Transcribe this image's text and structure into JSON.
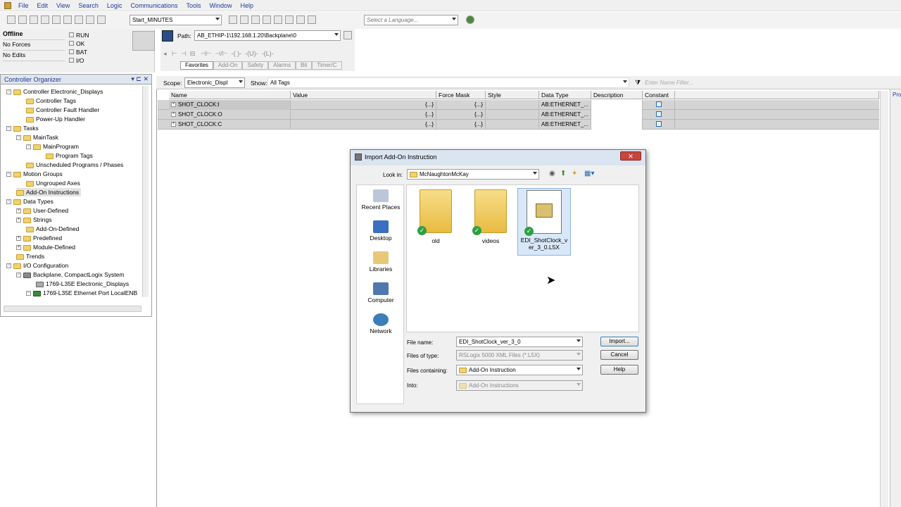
{
  "menu": [
    "File",
    "Edit",
    "View",
    "Search",
    "Logic",
    "Communications",
    "Tools",
    "Window",
    "Help"
  ],
  "toolbar": {
    "routine_combo": "Start_MINUTES",
    "language_placeholder": "Select a Language..."
  },
  "status": {
    "mode": "Offline",
    "forces": "No Forces",
    "edits": "No Edits",
    "indicators": [
      "RUN",
      "OK",
      "BAT",
      "I/O"
    ]
  },
  "path": {
    "label": "Path:",
    "value": "AB_ETHIP-1\\192.168.1.20\\Backplane\\0"
  },
  "instr_tabs": [
    "Favorites",
    "Add-On",
    "Safety",
    "Alarms",
    "Bit",
    "Timer/C"
  ],
  "organizer": {
    "title": "Controller Organizer",
    "items": [
      "Controller Electronic_Displays",
      "Controller Tags",
      "Controller Fault Handler",
      "Power-Up Handler",
      "Tasks",
      "MainTask",
      "MainProgram",
      "Program Tags",
      "Unscheduled Programs / Phases",
      "Motion Groups",
      "Ungrouped Axes",
      "Add-On Instructions",
      "Data Types",
      "User-Defined",
      "Strings",
      "Add-On-Defined",
      "Predefined",
      "Module-Defined",
      "Trends",
      "I/O Configuration",
      "Backplane, CompactLogix System",
      "1769-L35E Electronic_Displays",
      "1769-L35E Ethernet Port LocalENB"
    ]
  },
  "tags": {
    "scope_label": "Scope:",
    "scope_value": "Electronic_Displ",
    "show_label": "Show:",
    "show_value": "All Tags",
    "filter_placeholder": "Enter Name Filter...",
    "columns": [
      "Name",
      "Value",
      "Force Mask",
      "Style",
      "Data Type",
      "Description",
      "Constant"
    ],
    "rows": [
      {
        "name": "SHOT_CLOCK:I",
        "value": "{...}",
        "force": "{...}",
        "type": "AB:ETHERNET_..."
      },
      {
        "name": "SHOT_CLOCK:O",
        "value": "{...}",
        "force": "{...}",
        "type": "AB:ETHERNET_..."
      },
      {
        "name": "SHOT_CLOCK:C",
        "value": "{...}",
        "force": "{...}",
        "type": "AB:ETHERNET_..."
      }
    ]
  },
  "right_tab": "Pro",
  "dialog": {
    "title": "Import Add-On Instruction",
    "look_in_label": "Look in:",
    "look_in_value": "McNaughtonMcKay",
    "places": [
      "Recent Places",
      "Desktop",
      "Libraries",
      "Computer",
      "Network"
    ],
    "files": [
      {
        "name": "old"
      },
      {
        "name": "videos"
      },
      {
        "name": "EDI_ShotClock_ver_3_0.L5X"
      }
    ],
    "file_name_label": "File name:",
    "file_name_value": "EDI_ShotClock_ver_3_0",
    "file_type_label": "Files of type:",
    "file_type_value": "RSLogix 5000 XML Files (*.L5X)",
    "containing_label": "Files containing:",
    "containing_value": "Add-On Instruction",
    "into_label": "Into:",
    "into_value": "Add-On Instructions",
    "buttons": {
      "import": "Import...",
      "cancel": "Cancel",
      "help": "Help"
    }
  }
}
